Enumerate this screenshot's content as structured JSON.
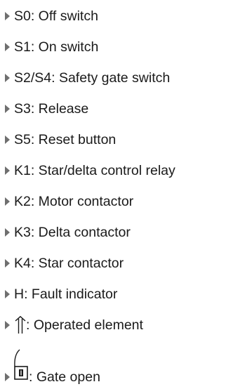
{
  "legend": {
    "items": [
      {
        "label": "S0: Off switch"
      },
      {
        "label": "S1: On switch"
      },
      {
        "label": "S2/S4: Safety gate switch"
      },
      {
        "label": "S3: Release"
      },
      {
        "label": "S5: Reset button"
      },
      {
        "label": "K1: Star/delta control relay"
      },
      {
        "label": "K2: Motor contactor"
      },
      {
        "label": "K3: Delta contactor"
      },
      {
        "label": "K4: Star contactor"
      },
      {
        "label": "H: Fault indicator"
      }
    ],
    "operated_element": {
      "symbol": "double-arrow-up-icon",
      "label": ": Operated element"
    },
    "gate_open": {
      "symbol": "gate-open-icon",
      "label": ": Gate open"
    }
  },
  "colors": {
    "text": "#1a1a1a",
    "bullet": "#6f6f6f"
  }
}
